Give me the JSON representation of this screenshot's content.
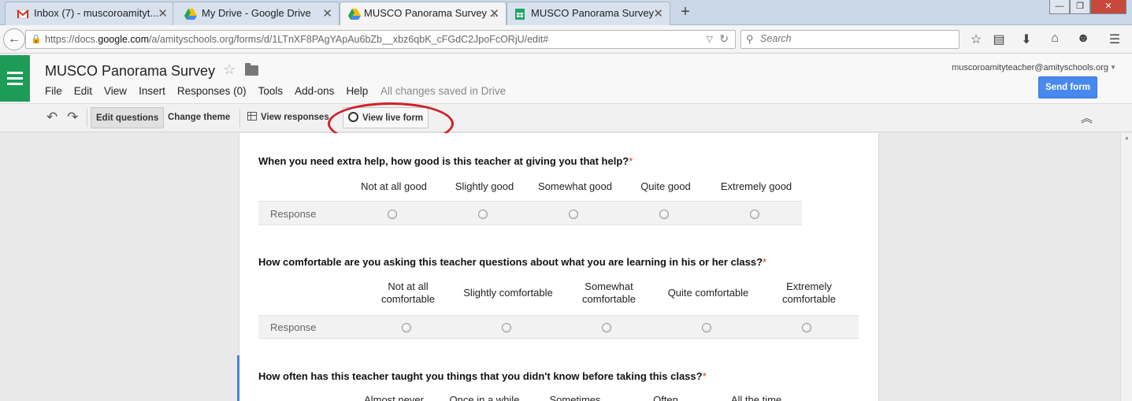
{
  "browser": {
    "tabs": [
      {
        "label": "Inbox (7) - muscoroamityt...",
        "icon": "gmail-icon"
      },
      {
        "label": "My Drive - Google Drive",
        "icon": "drive-icon"
      },
      {
        "label": "MUSCO Panorama Survey ...",
        "icon": "drive-icon",
        "active": true
      },
      {
        "label": "MUSCO Panorama Survey",
        "icon": "sheets-icon"
      }
    ],
    "new_tab": "+",
    "url_prefix": "https://docs.",
    "url_domain": "google.com",
    "url_rest": "/a/amityschools.org/forms/d/1LTnXF8PAgYApAu6bZb__xbz6qbK_cFGdC2JpoFcORjU/edit#",
    "search_placeholder": "Search"
  },
  "app": {
    "title": "MUSCO Panorama Survey",
    "menu": [
      "File",
      "Edit",
      "View",
      "Insert",
      "Responses (0)",
      "Tools",
      "Add-ons",
      "Help"
    ],
    "save_status": "All changes saved in Drive",
    "account": "muscoroamityteacher@amityschools.org",
    "send_button": "Send form"
  },
  "toolbar": {
    "edit_questions": "Edit questions",
    "change_theme": "Change theme",
    "view_responses": "View responses",
    "view_live_form": "View live form"
  },
  "questions": [
    {
      "text": "When you need extra help, how good is this teacher at giving you that help?",
      "required_mark": "*",
      "row_label": "Response",
      "columns": [
        "Not at all good",
        "Slightly good",
        "Somewhat good",
        "Quite good",
        "Extremely good"
      ]
    },
    {
      "text": "How comfortable are you asking this teacher questions about what you are learning in his or her class?",
      "required_mark": "*",
      "row_label": "Response",
      "columns": [
        "Not at all comfortable",
        "Slightly comfortable",
        "Somewhat comfortable",
        "Quite comfortable",
        "Extremely comfortable"
      ]
    },
    {
      "text": "How often has this teacher taught you things that you didn't know before taking this class?",
      "required_mark": "*",
      "columns": [
        "Almost never",
        "Once in a while",
        "Sometimes",
        "Often",
        "All the time"
      ]
    }
  ],
  "colors": {
    "forms_green": "#1d9c58",
    "send_blue": "#4889f0",
    "annotation_red": "#d0202a",
    "active_question_blue": "#4d7fe2"
  }
}
